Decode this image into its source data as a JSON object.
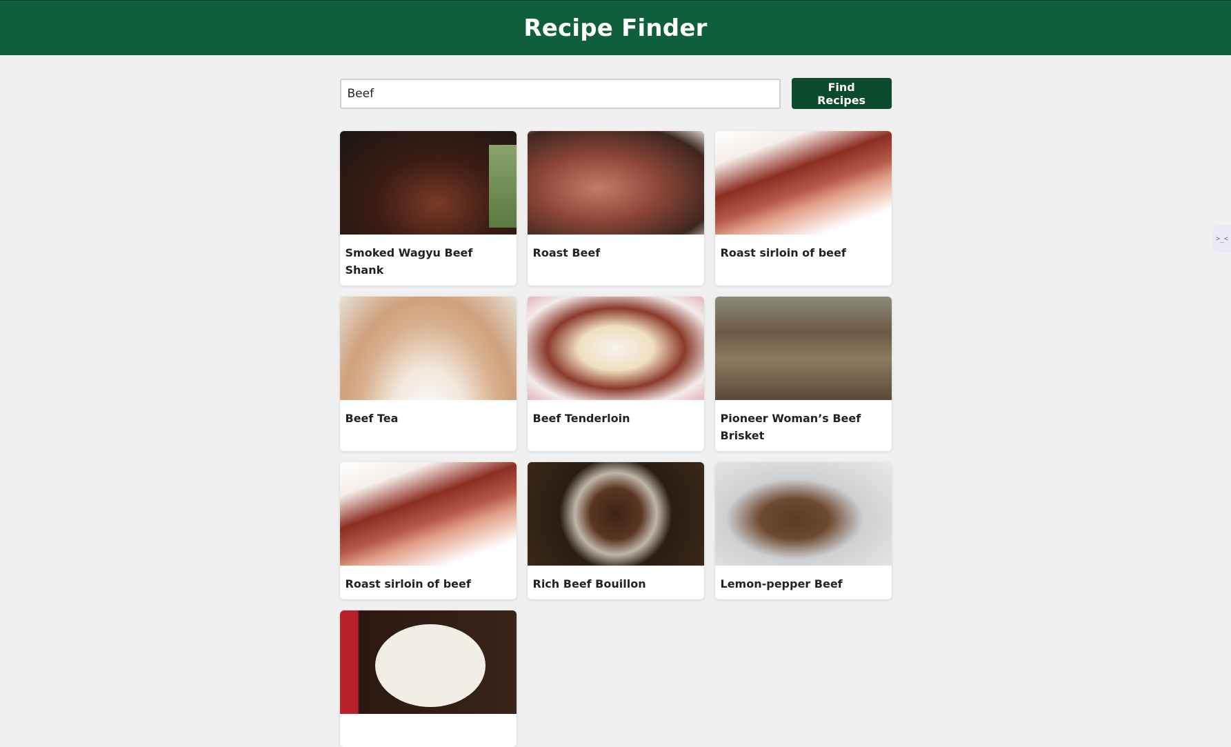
{
  "header": {
    "title": "Recipe Finder"
  },
  "search": {
    "value": "Beef",
    "button_label": "Find Recipes"
  },
  "results": [
    {
      "title": "Smoked Wagyu Beef Shank"
    },
    {
      "title": "Roast Beef"
    },
    {
      "title": "Roast sirloin of beef"
    },
    {
      "title": "Beef Tea"
    },
    {
      "title": "Beef Tenderloin"
    },
    {
      "title": "Pioneer Woman’s Beef Brisket"
    },
    {
      "title": "Roast sirloin of beef"
    },
    {
      "title": "Rich Beef Bouillon"
    },
    {
      "title": "Lemon-pepper Beef"
    },
    {
      "title": ""
    }
  ],
  "side_widget": {
    "icon": ">_<"
  },
  "colors": {
    "header_bg": "#0f5e3c",
    "button_bg": "#0b4a2b",
    "page_bg": "#f0f0f0"
  }
}
